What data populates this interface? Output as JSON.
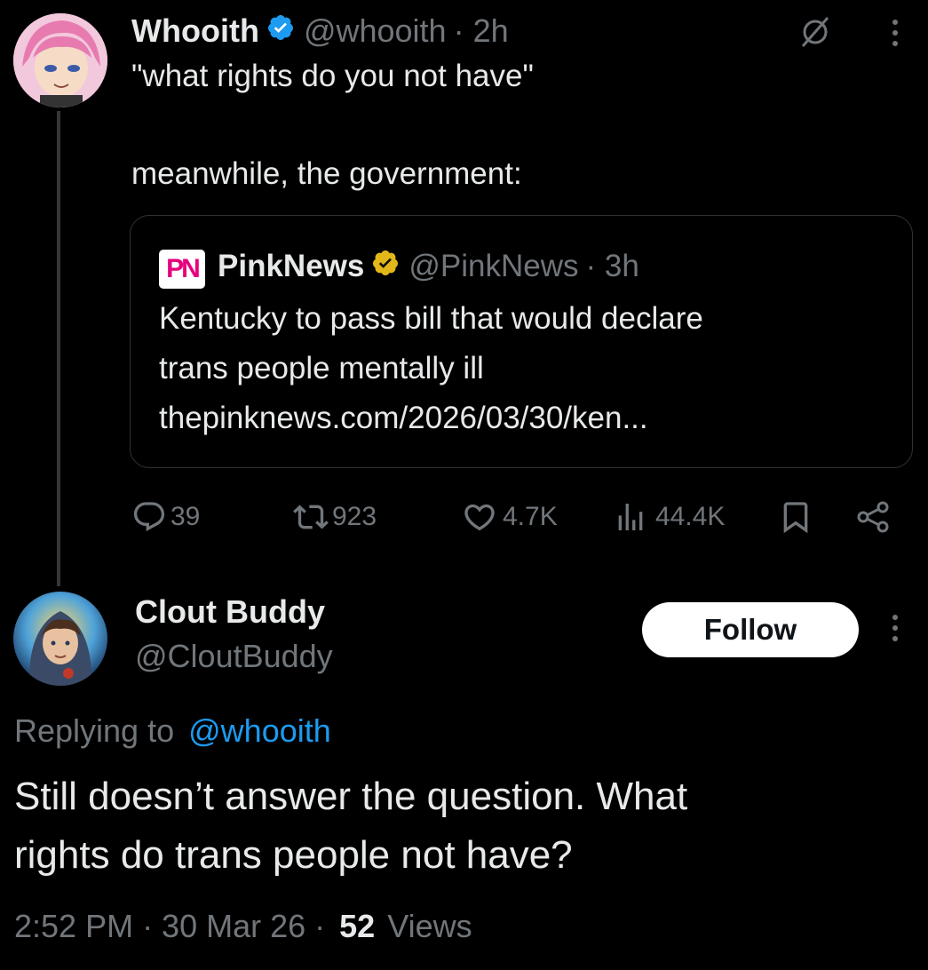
{
  "tweet": {
    "author_name": "Whooith",
    "handle": "@whooith",
    "time": "· 2h",
    "line1": "\"what rights do you not have\"",
    "line2": "meanwhile, the government:"
  },
  "quote": {
    "logo_text": "PN",
    "author_name": "PinkNews",
    "handle": "@PinkNews",
    "time": "· 3h",
    "line1": "Kentucky to pass bill that would declare",
    "line2": "trans people mentally ill",
    "link": "thepinknews.com/2026/03/30/ken..."
  },
  "actions": {
    "replies": "39",
    "reposts": "923",
    "likes": "4.7K",
    "views": "44.4K"
  },
  "reply": {
    "author_name": "Clout Buddy",
    "handle": "@CloutBuddy",
    "follow_label": "Follow",
    "replying_prefix": "Replying to",
    "replying_handle": "@whooith",
    "line1": "Still doesn’t answer the question. What",
    "line2": "rights do trans people not have?",
    "timestamp": "2:52 PM · 30 Mar 26 ·",
    "views_count": "52",
    "views_label": "Views"
  },
  "colors": {
    "background": "#000000",
    "text": "#e7e9ea",
    "muted": "#71767b",
    "link": "#1d9bf0",
    "verified_blue": "#1d9bf0",
    "verified_gold": "#e2b719"
  },
  "icons": [
    "verified-badge-icon",
    "grok-icon",
    "more-icon",
    "reply-icon",
    "repost-icon",
    "like-icon",
    "views-icon",
    "bookmark-icon",
    "share-icon"
  ]
}
